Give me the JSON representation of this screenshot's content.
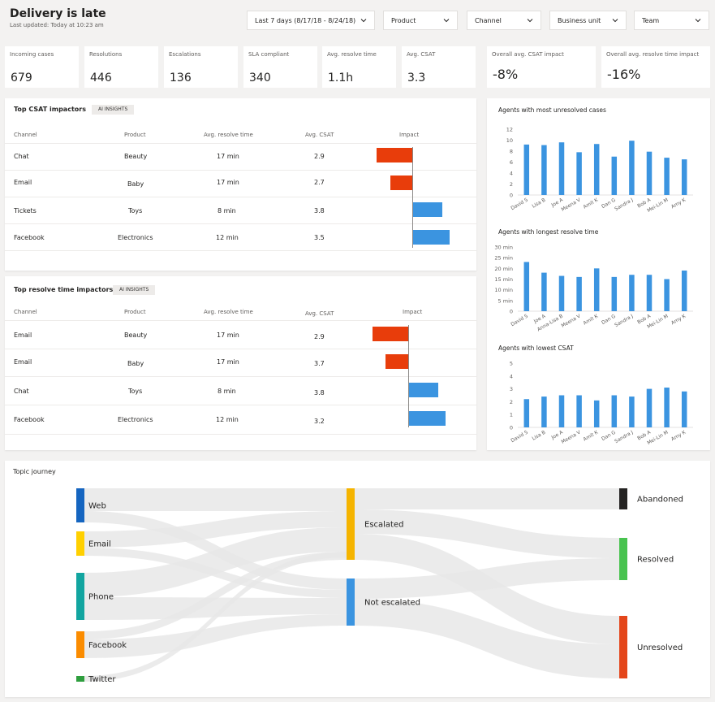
{
  "header": {
    "title": "Delivery is late",
    "subtitle": "Last updated: Today at 10:23 am"
  },
  "filters": [
    {
      "label": "Last 7 days (8/17/18 - 8/24/18)"
    },
    {
      "label": "Product"
    },
    {
      "label": "Channel"
    },
    {
      "label": "Business unit"
    },
    {
      "label": "Team"
    }
  ],
  "kpis": [
    {
      "label": "Incoming cases",
      "value": "679"
    },
    {
      "label": "Resolutions",
      "value": "446"
    },
    {
      "label": "Escalations",
      "value": "136"
    },
    {
      "label": "SLA compliant",
      "value": "340"
    },
    {
      "label": "Avg. resolve time",
      "value": "1.1h"
    },
    {
      "label": "Avg. CSAT",
      "value": "3.3"
    },
    {
      "label": "Overall avg. CSAT impact",
      "value": "-8%"
    },
    {
      "label": "Overall avg. resolve time impact",
      "value": "-16%"
    }
  ],
  "csat_table": {
    "title": "Top CSAT impactors",
    "badge": "AI INSIGHTS",
    "columns": [
      "Channel",
      "Product",
      "Avg. resolve time",
      "Avg. CSAT",
      "Impact"
    ],
    "rows": [
      {
        "channel": "Chat",
        "product": "Beauty",
        "time": "17 min",
        "csat": "2.9",
        "impact": -0.44
      },
      {
        "channel": "Email",
        "product": "Baby",
        "time": "17 min",
        "csat": "2.7",
        "impact": -0.27
      },
      {
        "channel": "Tickets",
        "product": "Toys",
        "time": "8 min",
        "csat": "3.8",
        "impact": 0.36
      },
      {
        "channel": "Facebook",
        "product": "Electronics",
        "time": "12 min",
        "csat": "3.5",
        "impact": 0.45
      }
    ]
  },
  "resolve_table": {
    "title": "Top resolve time impactors",
    "badge": "AI INSIGHTS",
    "columns": [
      "Channel",
      "Product",
      "Avg. resolve time",
      "Avg. CSAT",
      "Impact"
    ],
    "rows": [
      {
        "channel": "Email",
        "product": "Beauty",
        "time": "17 min",
        "csat": "2.9",
        "impact": -0.44
      },
      {
        "channel": "Email",
        "product": "Baby",
        "time": "17 min",
        "csat": "3.7",
        "impact": -0.28
      },
      {
        "channel": "Chat",
        "product": "Toys",
        "time": "8 min",
        "csat": "3.8",
        "impact": 0.36
      },
      {
        "channel": "Facebook",
        "product": "Electronics",
        "time": "12 min",
        "csat": "3.2",
        "impact": 0.45
      }
    ]
  },
  "colors": {
    "negative": "#e83d0b",
    "positive": "#3b94e0",
    "bar": "#3b94e0"
  },
  "chart_data": [
    {
      "type": "bar",
      "title": "Agents with most unresolved cases",
      "categories": [
        "David S",
        "Lisa B",
        "Joe A",
        "Meena V",
        "Amit K",
        "Dan G",
        "Sandra J",
        "Bob A",
        "Mei-Lin M",
        "Amy K"
      ],
      "values": [
        9.2,
        9.1,
        9.6,
        7.8,
        9.3,
        7.0,
        9.9,
        7.9,
        6.8,
        6.5
      ],
      "ylim": [
        0,
        12
      ],
      "yticks": [
        "0",
        "2",
        "4",
        "6",
        "8",
        "10",
        "12"
      ],
      "ytick_values": [
        0,
        2,
        4,
        6,
        8,
        10,
        12
      ]
    },
    {
      "type": "bar",
      "title": "Agents with longest resolve time",
      "categories": [
        "David S",
        "Joe A",
        "Anna-Lisa B",
        "Meena V",
        "Amit K",
        "Dan G",
        "Sandra J",
        "Bob A",
        "Mei-Lin M",
        "Amy K"
      ],
      "values": [
        23,
        18,
        16.5,
        16,
        20,
        16,
        17,
        17,
        15,
        19
      ],
      "ylim": [
        0,
        30
      ],
      "yticks": [
        "0",
        "5 min",
        "10 min",
        "15 min",
        "20 min",
        "25 min",
        "30 min"
      ],
      "ytick_values": [
        0,
        5,
        10,
        15,
        20,
        25,
        30
      ]
    },
    {
      "type": "bar",
      "title": "Agents with lowest CSAT",
      "categories": [
        "David S",
        "Lisa B",
        "Joe A",
        "Meena V",
        "Amit K",
        "Dan G",
        "Sandra J",
        "Bob A",
        "Mei-Lin M",
        "Amy K"
      ],
      "values": [
        2.2,
        2.4,
        2.5,
        2.5,
        2.1,
        2.5,
        2.4,
        3.0,
        3.1,
        2.8
      ],
      "ylim": [
        0,
        5
      ],
      "yticks": [
        "0",
        "1",
        "2",
        "3",
        "4",
        "5"
      ],
      "ytick_values": [
        0,
        1,
        2,
        3,
        4,
        5
      ]
    }
  ],
  "journey": {
    "title": "Topic journey",
    "sources": [
      {
        "label": "Web",
        "color": "#1565c0"
      },
      {
        "label": "Email",
        "color": "#ffd000"
      },
      {
        "label": "Phone",
        "color": "#12a5a0"
      },
      {
        "label": "Facebook",
        "color": "#fb8c00"
      },
      {
        "label": "Twitter",
        "color": "#2e9e3e"
      }
    ],
    "middle": [
      {
        "label": "Escalated",
        "color": "#f5b400"
      },
      {
        "label": "Not escalated",
        "color": "#3b94e0"
      }
    ],
    "targets": [
      {
        "label": "Abandoned",
        "color": "#252423"
      },
      {
        "label": "Resolved",
        "color": "#48c34f"
      },
      {
        "label": "Unresolved",
        "color": "#e4461b"
      }
    ]
  }
}
